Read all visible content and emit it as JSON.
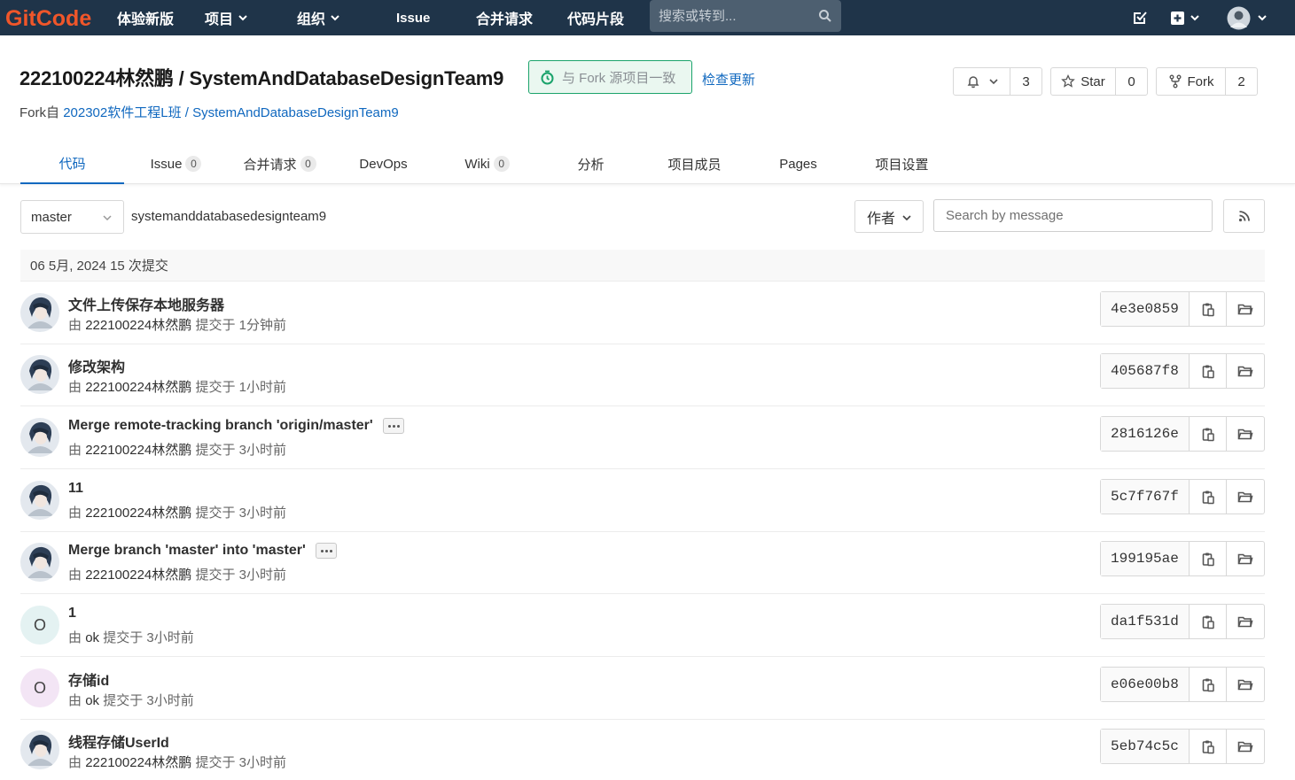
{
  "topbar": {
    "logo_text": "GitCode",
    "nav": [
      {
        "label": "体验新版",
        "dropdown": false
      },
      {
        "label": "项目",
        "dropdown": true
      },
      {
        "label": "组织",
        "dropdown": true
      },
      {
        "label": "Issue",
        "dropdown": false
      },
      {
        "label": "合并请求",
        "dropdown": false
      },
      {
        "label": "代码片段",
        "dropdown": false
      }
    ],
    "search_placeholder": "搜索或转到...",
    "icons": [
      "search-icon",
      "todo-check-icon",
      "plus-square-icon",
      "chevron-down-icon",
      "user-avatar",
      "chevron-down-icon"
    ],
    "bg_color": "#1f3449"
  },
  "project": {
    "title": "222100224林然鹏 / SystemAndDatabaseDesignTeam9",
    "sync_status": "与 Fork 源项目一致",
    "check_update": "检查更新",
    "fork_prefix": "Fork自",
    "fork_source": "202302软件工程L班 / SystemAndDatabaseDesignTeam9",
    "notify_count": "3",
    "star_label": "Star",
    "star_count": "0",
    "fork_label": "Fork",
    "fork_count": "2"
  },
  "tabs": [
    {
      "label": "代码",
      "count": null,
      "active": true
    },
    {
      "label": "Issue",
      "count": "0",
      "active": false
    },
    {
      "label": "合并请求",
      "count": "0",
      "active": false
    },
    {
      "label": "DevOps",
      "count": null,
      "active": false
    },
    {
      "label": "Wiki",
      "count": "0",
      "active": false
    },
    {
      "label": "分析",
      "count": null,
      "active": false
    },
    {
      "label": "项目成员",
      "count": null,
      "active": false
    },
    {
      "label": "Pages",
      "count": null,
      "active": false
    },
    {
      "label": "项目设置",
      "count": null,
      "active": false
    }
  ],
  "filters": {
    "branch": "master",
    "path": "systemanddatabasedesignteam9",
    "author_label": "作者",
    "search_placeholder": "Search by message"
  },
  "day_header": "06 5月, 2024 15 次提交",
  "commits": [
    {
      "title": "文件上传保存本地服务器",
      "author": "222100224林然鹏",
      "action": "提交于",
      "time": "1分钟前",
      "sha": "4e3e0859",
      "has_more": false,
      "avatar": "photo"
    },
    {
      "title": "修改架构",
      "author": "222100224林然鹏",
      "action": "提交于",
      "time": "1小时前",
      "sha": "405687f8",
      "has_more": false,
      "avatar": "photo"
    },
    {
      "title": "Merge remote-tracking branch 'origin/master'",
      "author": "222100224林然鹏",
      "action": "提交于",
      "time": "3小时前",
      "sha": "2816126e",
      "has_more": true,
      "avatar": "photo"
    },
    {
      "title": "11",
      "author": "222100224林然鹏",
      "action": "提交于",
      "time": "3小时前",
      "sha": "5c7f767f",
      "has_more": false,
      "avatar": "photo"
    },
    {
      "title": "Merge branch 'master' into 'master'",
      "author": "222100224林然鹏",
      "action": "提交于",
      "time": "3小时前",
      "sha": "199195ae",
      "has_more": true,
      "avatar": "photo"
    },
    {
      "title": "1",
      "author": "ok",
      "action": "提交于",
      "time": "3小时前",
      "sha": "da1f531d",
      "has_more": false,
      "avatar": "letter",
      "avatar_letter": "O",
      "avatar_bg": "#e4f2f2"
    },
    {
      "title": "存储id",
      "author": "ok",
      "action": "提交于",
      "time": "3小时前",
      "sha": "e06e00b8",
      "has_more": false,
      "avatar": "letter",
      "avatar_letter": "O",
      "avatar_bg": "#f3e5f5"
    },
    {
      "title": "线程存储UserId",
      "author": "222100224林然鹏",
      "action": "提交于",
      "time": "3小时前",
      "sha": "5eb74c5c",
      "has_more": false,
      "avatar": "photo"
    }
  ],
  "meta_prefix": "由",
  "colors": {
    "accent": "#1068bf",
    "sync_green": "#1aa36b",
    "logo_orange": "#f0562a"
  }
}
